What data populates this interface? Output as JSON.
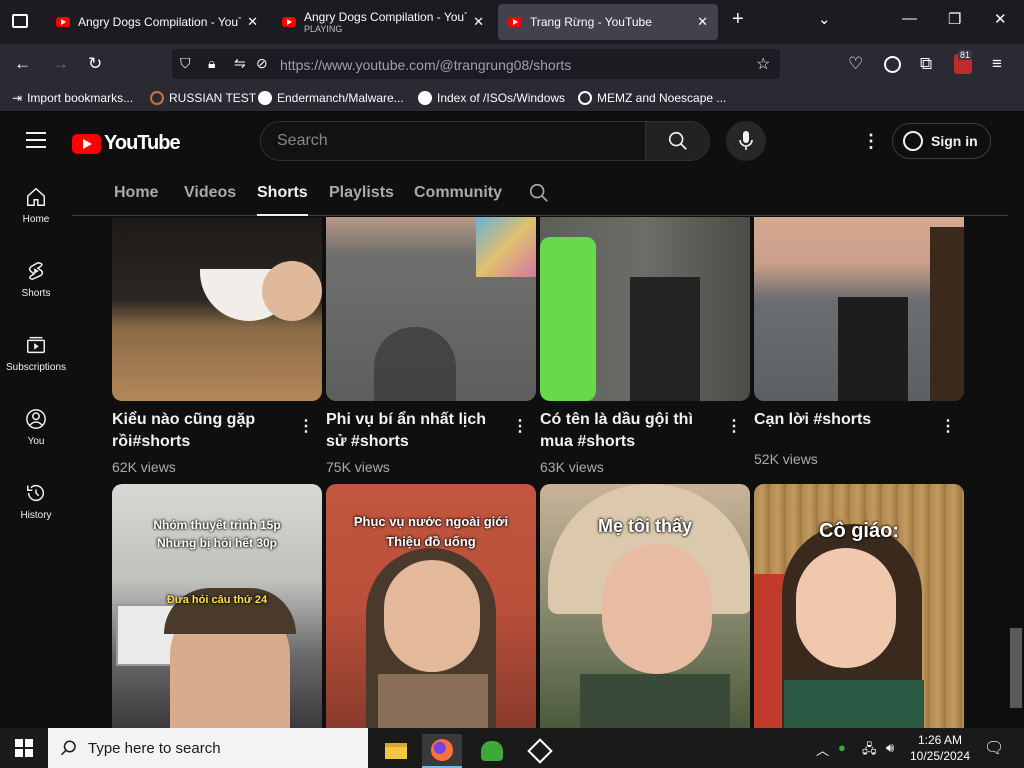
{
  "browser": {
    "tabs": [
      {
        "title": "Angry Dogs Compilation - YouTube",
        "subtitle": ""
      },
      {
        "title": "Angry Dogs Compilation - YouTube",
        "subtitle": "PLAYING"
      },
      {
        "title": "Trang Rừng - YouTube",
        "subtitle": ""
      }
    ],
    "new_tab": "+",
    "url": "https://www.youtube.com/@trangrung08/shorts",
    "notification_count": "81",
    "bookmarks": [
      "Import bookmarks...",
      "RUSSIAN TEST",
      "Endermanch/Malware...",
      "Index of /ISOs/Windows",
      "MEMZ and Noescape ..."
    ]
  },
  "youtube": {
    "logo_text": "YouTube",
    "search_placeholder": "Search",
    "sign_in": "Sign in",
    "sidebar": [
      {
        "label": "Home",
        "icon": "home-icon"
      },
      {
        "label": "Shorts",
        "icon": "shorts-icon"
      },
      {
        "label": "Subscriptions",
        "icon": "subscriptions-icon"
      },
      {
        "label": "You",
        "icon": "you-icon"
      },
      {
        "label": "History",
        "icon": "history-icon"
      }
    ],
    "channel_tabs": [
      "Home",
      "Videos",
      "Shorts",
      "Playlists",
      "Community"
    ],
    "active_tab": "Shorts",
    "shorts_row1": [
      {
        "title": "Kiểu nào cũng gặp rồi#shorts",
        "views": "62K views"
      },
      {
        "title": "Phi vụ bí ẩn nhất lịch sử #shorts",
        "views": "75K views"
      },
      {
        "title": "Có tên là dầu gội thì mua #shorts",
        "views": "63K views"
      },
      {
        "title": "Cạn lời #shorts",
        "views": "52K views"
      }
    ],
    "shorts_row2_captions": [
      {
        "line1": "Nhóm thuyết trình 15p",
        "line2": "Nhưng bị hỏi hết 30p",
        "line3": "Đưa hỏi câu thứ 24"
      },
      {
        "line1": "Phục vụ nước ngoài giới",
        "line2": "Thiệu đồ uống",
        "line3": ""
      },
      {
        "line1": "Mẹ tôi thấy",
        "line2": "",
        "line3": ""
      },
      {
        "line1": "Cô giáo:",
        "line2": "",
        "line3": ""
      }
    ]
  },
  "taskbar": {
    "search_placeholder": "Type here to search",
    "time": "1:26 AM",
    "date": "10/25/2024"
  }
}
